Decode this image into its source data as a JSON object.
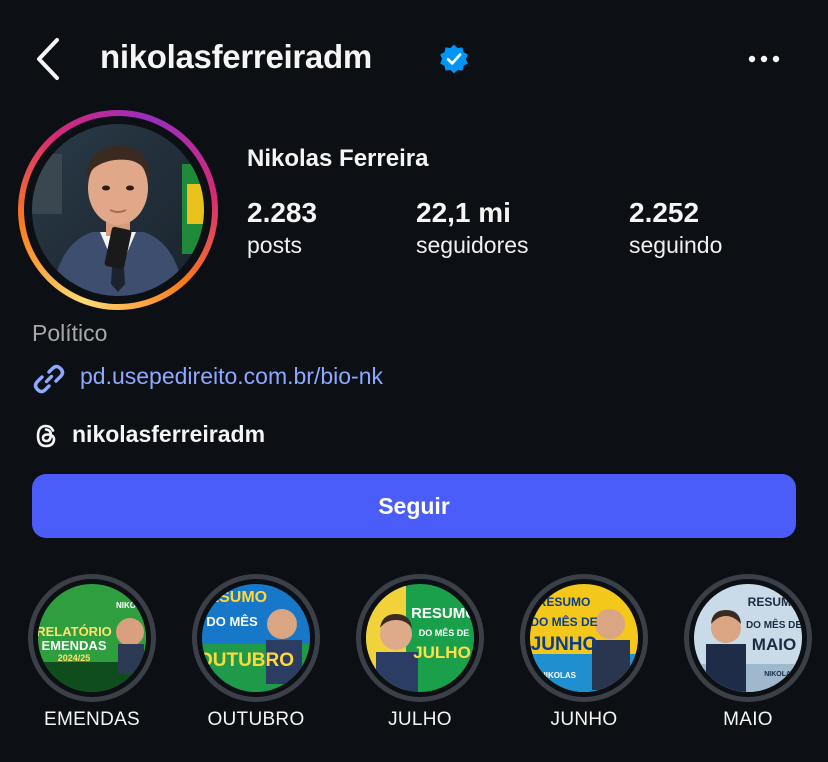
{
  "header": {
    "username": "nikolasferreiradm",
    "back_icon": "chevron-left-icon",
    "verified_icon": "verified-badge-icon",
    "more_icon": "more-horizontal-icon"
  },
  "profile": {
    "full_name": "Nikolas Ferreira",
    "stats": [
      {
        "value": "2.283",
        "label": "posts"
      },
      {
        "value": "22,1 mi",
        "label": "seguidores"
      },
      {
        "value": "2.252",
        "label": "seguindo"
      }
    ],
    "category": "Político",
    "link": "pd.usepedireito.com.br/bio-nk",
    "threads_handle": "nikolasferreiradm"
  },
  "actions": {
    "follow_label": "Seguir"
  },
  "highlights": [
    {
      "label": "EMENDAS",
      "art": {
        "title_lines": [
          "RELATÓRIO",
          "EMENDAS",
          "2024/25"
        ],
        "brand": "NIKOLAS"
      }
    },
    {
      "label": "OUTUBRO",
      "art": {
        "title_lines": [
          "RESUMO",
          "DO MÊS",
          "OUTUBRO"
        ]
      }
    },
    {
      "label": "JULHO",
      "art": {
        "title_lines": [
          "RESUMO",
          "DO MÊS DE",
          "JULHO"
        ]
      }
    },
    {
      "label": "JUNHO",
      "art": {
        "title_lines": [
          "RESUMO",
          "DO MÊS DE",
          "JUNHO"
        ],
        "brand": "NIKOLAS"
      }
    },
    {
      "label": "MAIO",
      "art": {
        "title_lines": [
          "RESUMO",
          "DO MÊS DE",
          "MAIO"
        ],
        "brand": "NIKOLAS"
      }
    }
  ],
  "colors": {
    "background": "#0c1014",
    "follow_button": "#4a5df9",
    "link": "#8ea8ff",
    "verified": "#0095f6",
    "secondary_text": "#a8a8a8"
  }
}
